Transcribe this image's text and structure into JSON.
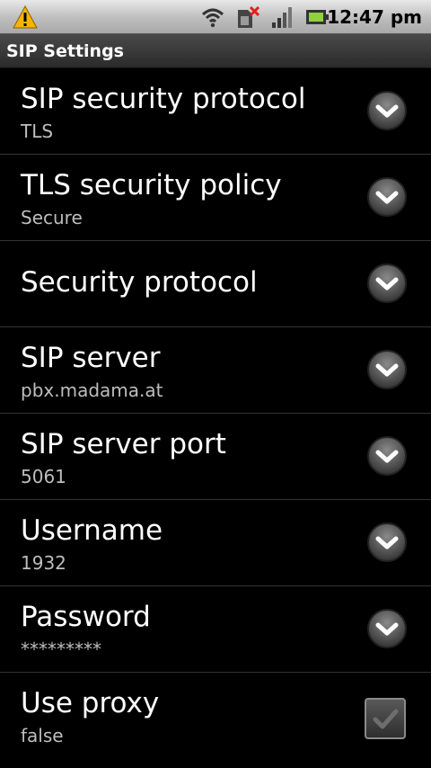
{
  "status": {
    "time": "12:47 pm"
  },
  "header": {
    "title": "SIP Settings"
  },
  "settings": [
    {
      "label": "SIP security protocol",
      "value": "TLS",
      "control": "dropdown"
    },
    {
      "label": "TLS security policy",
      "value": "Secure",
      "control": "dropdown"
    },
    {
      "label": "Security protocol",
      "value": "",
      "control": "dropdown"
    },
    {
      "label": "SIP server",
      "value": "pbx.madama.at",
      "control": "dropdown"
    },
    {
      "label": "SIP server port",
      "value": "5061",
      "control": "dropdown"
    },
    {
      "label": "Username",
      "value": "1932",
      "control": "dropdown"
    },
    {
      "label": "Password",
      "value": "*********",
      "control": "dropdown"
    },
    {
      "label": "Use proxy",
      "value": "false",
      "control": "checkbox",
      "checked": false
    }
  ],
  "icons": {
    "warning": "warning-icon",
    "wifi": "wifi-icon",
    "sim": "sim-error-icon",
    "signal": "signal-icon",
    "battery": "battery-icon",
    "dropdown": "chevron-down-icon",
    "checkbox": "check-icon"
  },
  "colors": {
    "accent_warning": "#f5b400",
    "sim_error": "#e02020",
    "battery": "#8fd23c"
  }
}
